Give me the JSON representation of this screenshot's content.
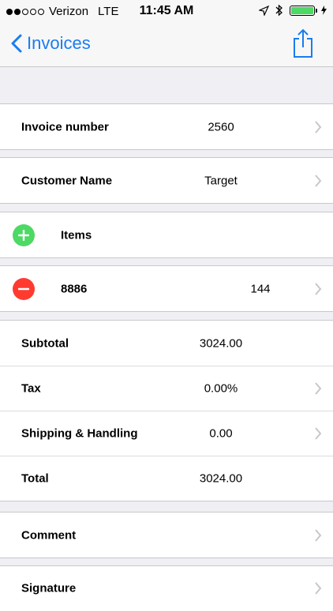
{
  "status": {
    "carrier": "Verizon",
    "network": "LTE",
    "time": "11:45 AM",
    "battery_level": 1.0
  },
  "nav": {
    "back_label": "Invoices"
  },
  "invoice": {
    "label": "Invoice number",
    "value": "2560"
  },
  "customer": {
    "label": "Customer Name",
    "value": "Target"
  },
  "items": {
    "header_label": "Items",
    "list": [
      {
        "name": "8886",
        "qty": "144"
      }
    ]
  },
  "totals": [
    {
      "label": "Subtotal",
      "value": "3024.00",
      "chevron": false
    },
    {
      "label": "Tax",
      "value": "0.00%",
      "chevron": true
    },
    {
      "label": "Shipping & Handling",
      "value": "0.00",
      "chevron": true
    },
    {
      "label": "Total",
      "value": "3024.00",
      "chevron": false
    }
  ],
  "comment": {
    "label": "Comment"
  },
  "signature": {
    "label": "Signature"
  },
  "colors": {
    "accent": "#1a7cf0",
    "add": "#4cd964",
    "remove": "#ff3b30",
    "background": "#efeff4"
  }
}
